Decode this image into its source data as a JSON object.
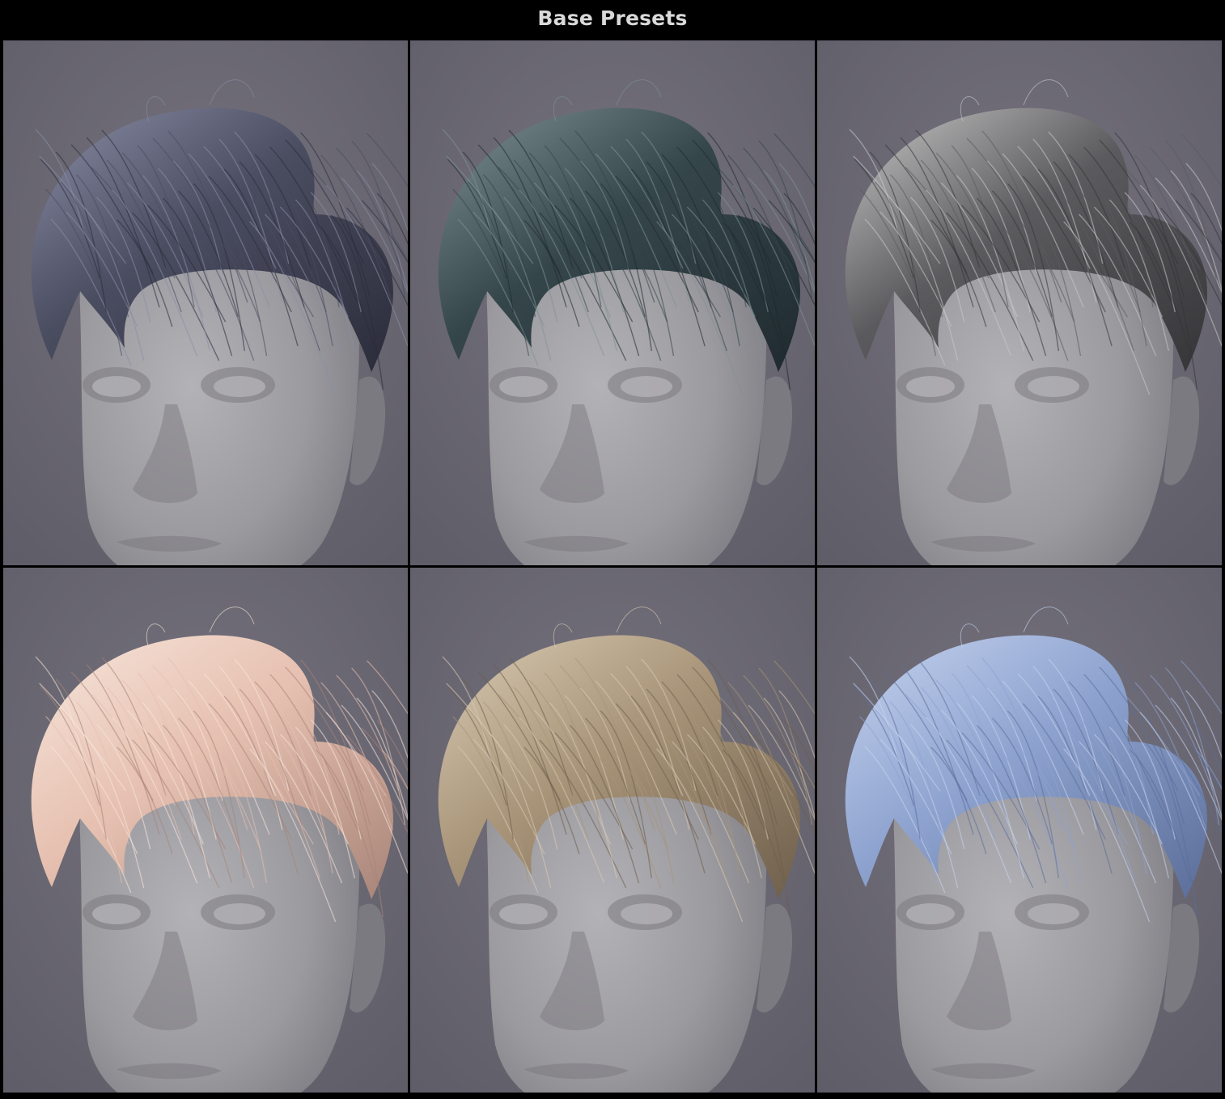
{
  "header": {
    "title": "Base Presets"
  },
  "presets": [
    {
      "hair_color": "#4a4c60",
      "hair_highlight": "#8a8ea6",
      "hair_shadow": "#2b2c3a"
    },
    {
      "hair_color": "#35464b",
      "hair_highlight": "#7f9296",
      "hair_shadow": "#1f2a2e"
    },
    {
      "hair_color": "#5b5b5e",
      "hair_highlight": "#c9c9c9",
      "hair_shadow": "#353538"
    },
    {
      "hair_color": "#e6c0b0",
      "hair_highlight": "#f7e6dc",
      "hair_shadow": "#a78478"
    },
    {
      "hair_color": "#a89478",
      "hair_highlight": "#d8cbb4",
      "hair_shadow": "#6e5f4c"
    },
    {
      "hair_color": "#8ea3cf",
      "hair_highlight": "#c6d3ef",
      "hair_shadow": "#5b6d99"
    }
  ],
  "style": {
    "background": "#6c6a75",
    "skin": "#9b9a9f",
    "skin_shadow": "#7b7a80",
    "skin_light": "#b3b2b7"
  }
}
